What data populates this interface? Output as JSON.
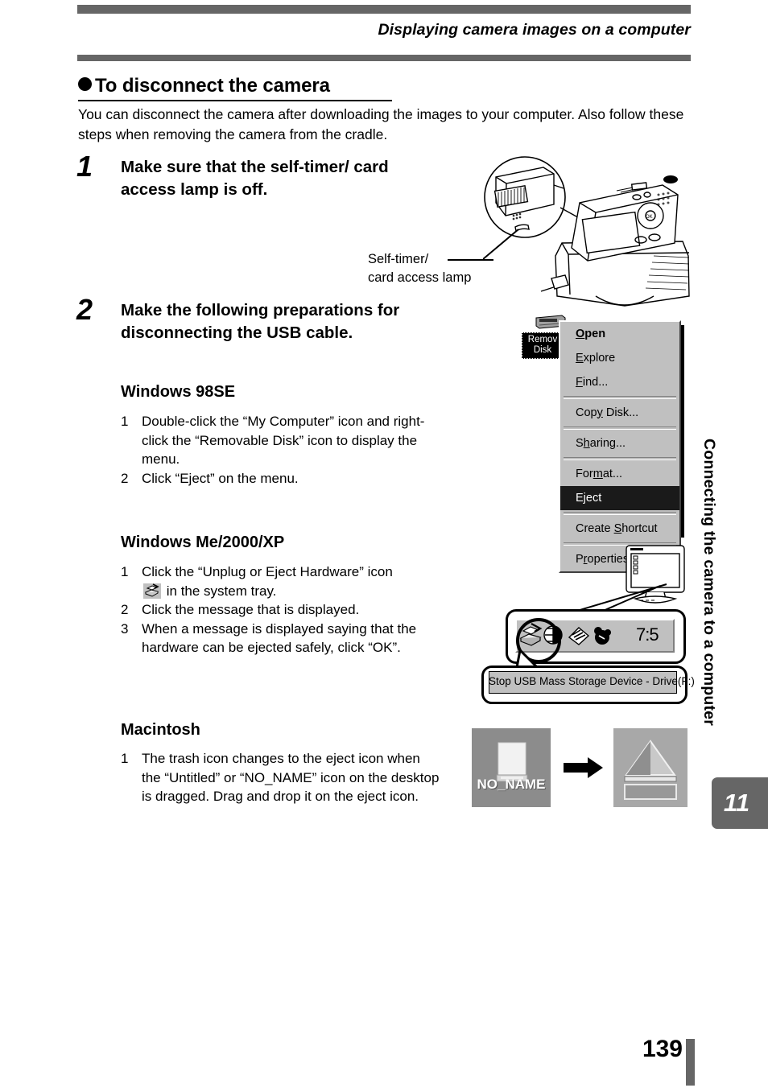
{
  "header": {
    "running_title": "Displaying camera images on a computer"
  },
  "section": {
    "heading": "To disconnect the camera",
    "intro": "You can disconnect the camera after downloading the images to your computer. Also follow these steps when removing the camera from the cradle."
  },
  "steps": [
    {
      "number": "1",
      "text": "Make sure that the self-timer/ card access lamp is off."
    },
    {
      "number": "2",
      "text": "Make the following preparations for disconnecting the USB cable."
    }
  ],
  "callout": {
    "label_line1": "Self-timer/",
    "label_line2": "card access lamp"
  },
  "os_sections": [
    {
      "title": "Windows 98SE",
      "items": [
        {
          "n": "1",
          "text": "Double-click the “My Computer” icon and right-click the “Removable Disk” icon to display the menu."
        },
        {
          "n": "2",
          "text": "Click “Eject” on the menu."
        }
      ]
    },
    {
      "title": "Windows Me/2000/XP",
      "items": [
        {
          "n": "1",
          "text_before": "Click the “Unplug or Eject Hardware” icon",
          "text_after": "in the system tray."
        },
        {
          "n": "2",
          "text": "Click the message that is displayed."
        },
        {
          "n": "3",
          "text": "When a message is displayed saying that the hardware can be ejected safely, click “OK”."
        }
      ]
    },
    {
      "title": "Macintosh",
      "items": [
        {
          "n": "1",
          "text": "The trash icon changes to the eject icon when the “Untitled” or “NO_NAME” icon on the desktop is dragged. Drag and drop it on the eject icon."
        }
      ]
    }
  ],
  "context_menu": {
    "desktop_icon_label_line1": "Remov",
    "desktop_icon_label_line2": "Disk",
    "items": [
      {
        "label": "Open",
        "accel": "O",
        "bold": true,
        "selected": false
      },
      {
        "label": "Explore",
        "accel": "E",
        "bold": false,
        "selected": false
      },
      {
        "label": "Find...",
        "accel": "F",
        "bold": false,
        "selected": false
      },
      {
        "separator": true
      },
      {
        "label": "Copy Disk...",
        "accel": "y",
        "bold": false,
        "selected": false
      },
      {
        "separator": true
      },
      {
        "label": "Sharing...",
        "accel": "h",
        "bold": false,
        "selected": false
      },
      {
        "separator": true
      },
      {
        "label": "Format...",
        "accel": "m",
        "bold": false,
        "selected": false
      },
      {
        "label": "Eject",
        "accel": "j",
        "bold": false,
        "selected": true
      },
      {
        "separator": true
      },
      {
        "label": "Create Shortcut",
        "accel": "S",
        "bold": false,
        "selected": false
      },
      {
        "separator": true
      },
      {
        "label": "Properties",
        "accel": "r",
        "bold": false,
        "selected": false
      }
    ]
  },
  "systray": {
    "clock": "7:5",
    "tooltip": "Stop USB Mass Storage Device - Drive(F:)"
  },
  "mac_icons": {
    "volume_label": "NO_NAME"
  },
  "side_tab": {
    "chapter_title": "Connecting the camera to a computer",
    "chapter_number": "11"
  },
  "footer": {
    "page_number": "139"
  },
  "colors": {
    "rule_gray": "#666666",
    "menu_face": "#c0c0c0",
    "selection": "#1a1a1a"
  }
}
